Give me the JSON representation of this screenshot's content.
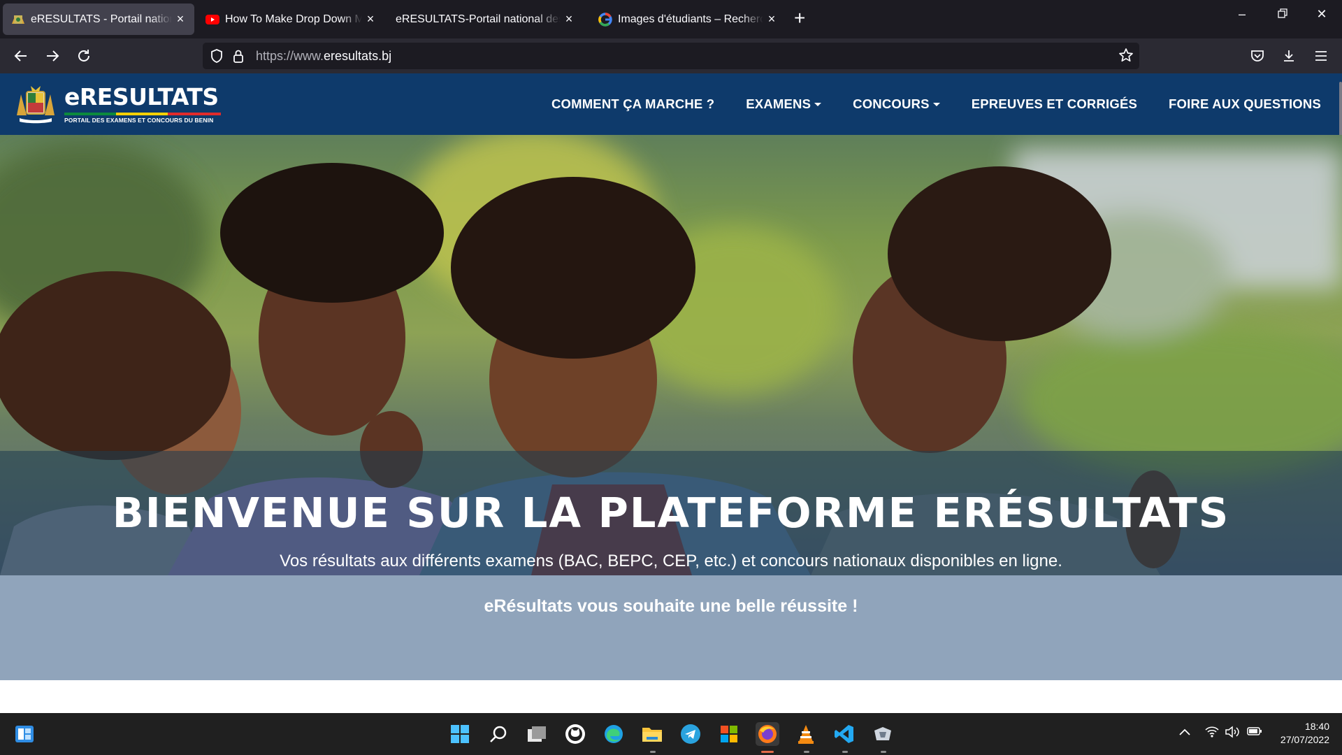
{
  "browser": {
    "tabs": [
      {
        "title": "eRESULTATS - Portail national des examens",
        "active": true,
        "favicon": "benin-coat-of-arms-icon"
      },
      {
        "title": "How To Make Drop Down Menu",
        "active": false,
        "favicon": "youtube-icon"
      },
      {
        "title": "eRESULTATS-Portail national des examens",
        "active": false,
        "favicon": "none"
      },
      {
        "title": "Images d'étudiants – Recherche Google",
        "active": false,
        "favicon": "google-icon"
      }
    ],
    "url_prefix": "https://www.",
    "url_domain": "eresultats.bj"
  },
  "site": {
    "logo_name": "eRESULTATS",
    "logo_subtitle": "PORTAIL DES EXAMENS ET CONCOURS DU BENIN",
    "menu": [
      {
        "label": "COMMENT ÇA MARCHE ?",
        "dropdown": false
      },
      {
        "label": "EXAMENS",
        "dropdown": true
      },
      {
        "label": "CONCOURS",
        "dropdown": true
      },
      {
        "label": "EPREUVES ET CORRIGÉS",
        "dropdown": false
      },
      {
        "label": "FOIRE AUX QUESTIONS",
        "dropdown": false
      }
    ],
    "colors": {
      "header": "#0e3a6b",
      "wish_band": "#90a4bb"
    }
  },
  "hero": {
    "title": "BIENVENUE SUR LA PLATEFORME ERÉSULTATS",
    "subtitle": "Vos résultats aux différents examens (BAC, BEPC, CEP, etc.) et concours nationaux disponibles en ligne.",
    "wish": "eRésultats vous souhaite une belle réussite !"
  },
  "taskbar": {
    "apps": [
      "windows-start",
      "search",
      "task-view",
      "github",
      "edge",
      "file-explorer",
      "telegram",
      "microsoft-store",
      "firefox",
      "vlc",
      "vscode",
      "other-app"
    ],
    "time": "18:40",
    "date": "27/07/2022"
  }
}
